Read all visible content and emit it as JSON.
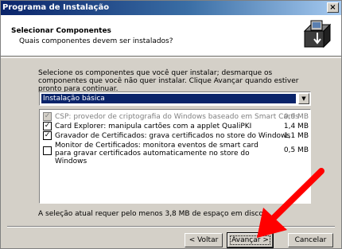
{
  "window": {
    "title": "Programa de Instalação",
    "close_glyph": "×"
  },
  "header": {
    "title": "Selecionar Componentes",
    "subtitle": "Quais componentes devem ser instalados?",
    "icon": "installer-box-icon"
  },
  "intro": "Selecione os componentes que você quer instalar; desmarque os componentes que você não quer instalar. Clique Avançar quando estiver pronto para continuar.",
  "install_type": {
    "selected": "Instalação básica"
  },
  "components": [
    {
      "label": "CSP: provedor de criptografia do Windows baseado em Smart Cards",
      "size": "0,9 MB",
      "checked": true,
      "disabled": true
    },
    {
      "label": "Card Explorer: manipula cartões com a applet QualiPKI",
      "size": "1,4 MB",
      "checked": true,
      "disabled": false
    },
    {
      "label": "Gravador de Certificados: grava certificados no store do Windows",
      "size": "1,1 MB",
      "checked": true,
      "disabled": false
    },
    {
      "label": "Monitor de Certificados: monitora eventos de smart card para gravar certificados automaticamente no store do Windows",
      "size": "0,5 MB",
      "checked": false,
      "disabled": false
    }
  ],
  "space_required": "A seleção atual requer pelo menos 3,8 MB de espaço em disco.",
  "buttons": {
    "back": "< Voltar",
    "next": "Avançar >",
    "cancel": "Cancelar"
  },
  "colors": {
    "titlebar": "#0a246a",
    "selection": "#0a246a",
    "arrow": "#ff0000"
  }
}
